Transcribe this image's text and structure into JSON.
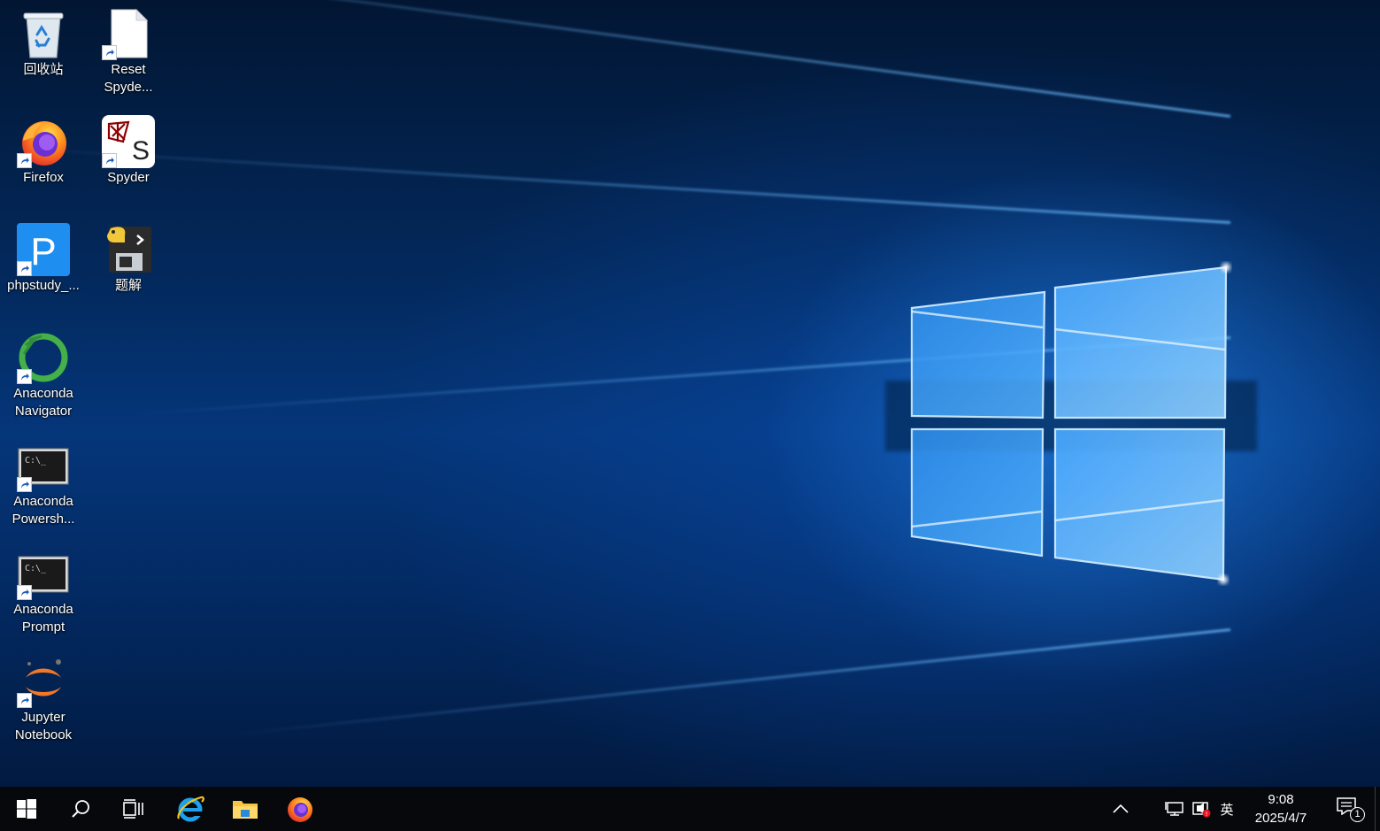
{
  "desktop": {
    "icons": [
      {
        "label": "回收站",
        "icon": "recycle-bin-icon"
      },
      {
        "label": "Reset\nSpyde...",
        "icon": "document-icon"
      },
      {
        "label": "Firefox",
        "icon": "firefox-icon"
      },
      {
        "label": "Spyder",
        "icon": "spyder-icon"
      },
      {
        "label": "phpstudy_...",
        "icon": "phpstudy-icon"
      },
      {
        "label": "题解",
        "icon": "python-icon"
      },
      {
        "label": "Anaconda\nNavigator",
        "icon": "anaconda-icon"
      },
      {
        "label": "Anaconda\nPowersh...",
        "icon": "terminal-icon"
      },
      {
        "label": "Anaconda\nPrompt",
        "icon": "terminal-icon"
      },
      {
        "label": "Jupyter\nNotebook",
        "icon": "jupyter-icon"
      }
    ]
  },
  "taskbar": {
    "pinned": [
      "start-icon",
      "search-icon",
      "task-view-icon",
      "internet-explorer-icon",
      "file-explorer-icon",
      "firefox-icon"
    ],
    "tray": {
      "input_language": "英",
      "time": "9:08",
      "date": "2025/4/7",
      "notification_count": "1"
    }
  },
  "colors": {
    "taskbar": "#06080b",
    "wallpaper_dark": "#021633",
    "wallpaper_glow": "#4aa8ff"
  }
}
